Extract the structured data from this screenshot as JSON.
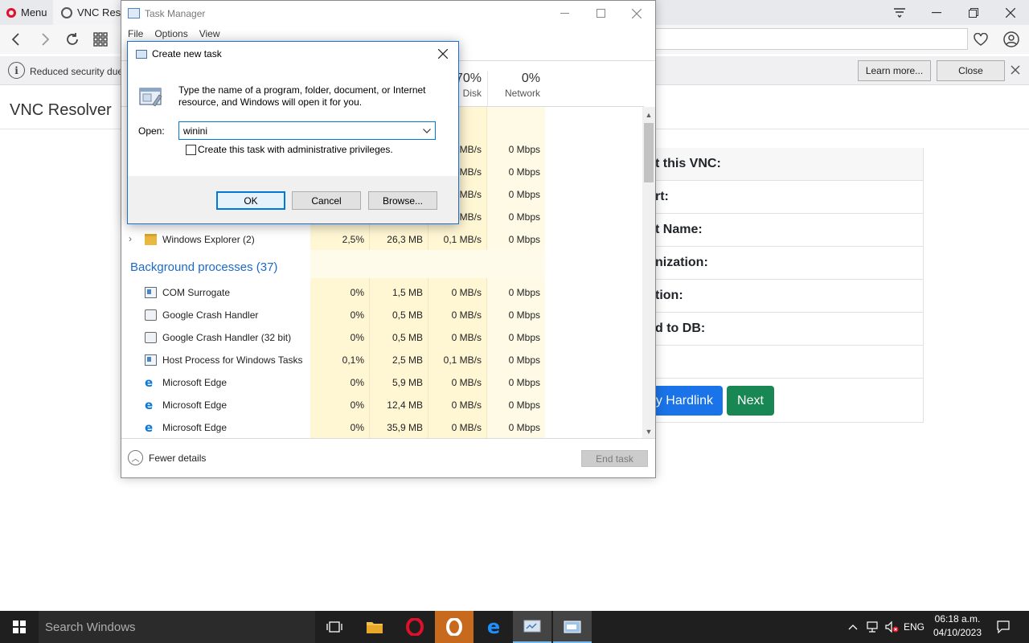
{
  "browser": {
    "menu_label": "Menu",
    "tab_title": "VNC Resolver",
    "security_message": "Reduced security due",
    "learn_more_label": "Learn more...",
    "close_label": "Close"
  },
  "page": {
    "site_title": "VNC Resolver",
    "card_rows": [
      "t this VNC:",
      "rt:",
      "t Name:",
      "nization:",
      "tion:",
      "d to DB:"
    ],
    "hardlink_label": "y Hardlink",
    "next_label": "Next"
  },
  "task_manager": {
    "title": "Task Manager",
    "menu": [
      "File",
      "Options",
      "View"
    ],
    "columns": [
      {
        "pct": "70%",
        "name": "Disk"
      },
      {
        "pct": "0%",
        "name": "Network"
      }
    ],
    "partial_rows": [
      {
        "disk": "MB/s",
        "net": "0 Mbps"
      },
      {
        "disk": "MB/s",
        "net": "0 Mbps"
      },
      {
        "disk": "MB/s",
        "net": "0 Mbps"
      },
      {
        "disk": "MB/s",
        "net": "0 Mbps"
      }
    ],
    "app_row": {
      "name": "Windows Explorer (2)",
      "cpu": "2,5%",
      "mem": "26,3 MB",
      "disk": "0,1 MB/s",
      "net": "0 Mbps"
    },
    "background_label": "Background processes (37)",
    "processes": [
      {
        "name": "COM Surrogate",
        "cpu": "0%",
        "mem": "1,5 MB",
        "disk": "0 MB/s",
        "net": "0 Mbps",
        "icon": "window-icon"
      },
      {
        "name": "Google Crash Handler",
        "cpu": "0%",
        "mem": "0,5 MB",
        "disk": "0 MB/s",
        "net": "0 Mbps",
        "icon": "gear-icon"
      },
      {
        "name": "Google Crash Handler (32 bit)",
        "cpu": "0%",
        "mem": "0,5 MB",
        "disk": "0 MB/s",
        "net": "0 Mbps",
        "icon": "gear-icon"
      },
      {
        "name": "Host Process for Windows Tasks",
        "cpu": "0,1%",
        "mem": "2,5 MB",
        "disk": "0,1 MB/s",
        "net": "0 Mbps",
        "icon": "window-icon"
      },
      {
        "name": "Microsoft Edge",
        "cpu": "0%",
        "mem": "5,9 MB",
        "disk": "0 MB/s",
        "net": "0 Mbps",
        "icon": "edge-icon"
      },
      {
        "name": "Microsoft Edge",
        "cpu": "0%",
        "mem": "12,4 MB",
        "disk": "0 MB/s",
        "net": "0 Mbps",
        "icon": "edge-icon"
      },
      {
        "name": "Microsoft Edge",
        "cpu": "0%",
        "mem": "35,9 MB",
        "disk": "0 MB/s",
        "net": "0 Mbps",
        "icon": "edge-icon"
      }
    ],
    "fewer_details_label": "Fewer details",
    "end_task_label": "End task"
  },
  "dialog": {
    "title": "Create new task",
    "description": "Type the name of a program, folder, document, or Internet resource, and Windows will open it for you.",
    "open_label": "Open:",
    "open_value": "winini",
    "admin_label": "Create this task with administrative privileges.",
    "ok_label": "OK",
    "cancel_label": "Cancel",
    "browse_label": "Browse..."
  },
  "taskbar": {
    "search_placeholder": "Search Windows",
    "language": "ENG",
    "time": "06:18 a.m.",
    "date": "04/10/2023"
  },
  "colors": {
    "accent": "#0078d7",
    "opera_red": "#e0102a",
    "next_green": "#198754",
    "hardlink_blue": "#1a73e8",
    "heat_yellow": "#fff6d4"
  }
}
